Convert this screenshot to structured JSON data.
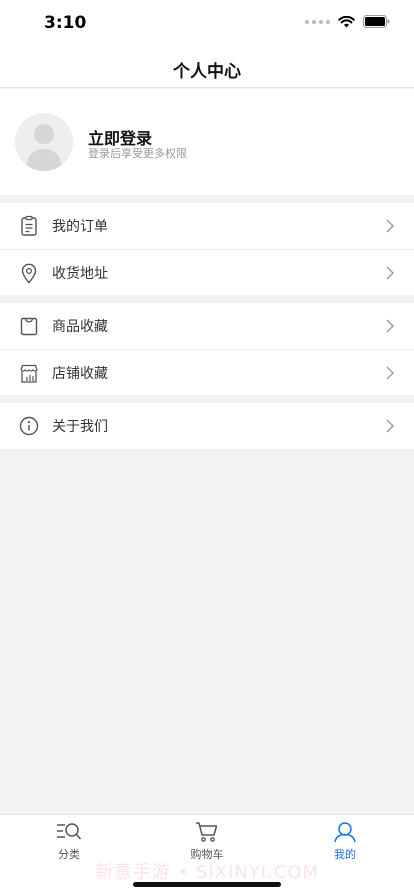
{
  "status_bar": {
    "time": "3:10"
  },
  "nav": {
    "title": "个人中心"
  },
  "profile": {
    "login_title": "立即登录",
    "login_subtitle": "登录后享受更多权限"
  },
  "menu_groups": [
    [
      {
        "label": "我的订单",
        "icon": "order-list-icon"
      },
      {
        "label": "收货地址",
        "icon": "location-pin-icon"
      }
    ],
    [
      {
        "label": "商品收藏",
        "icon": "shopping-bag-icon"
      },
      {
        "label": "店铺收藏",
        "icon": "store-icon"
      }
    ],
    [
      {
        "label": "关于我们",
        "icon": "info-icon"
      }
    ]
  ],
  "tab_bar": {
    "tabs": [
      {
        "label": "分类",
        "icon": "category-search-icon",
        "active": false
      },
      {
        "label": "购物车",
        "icon": "cart-icon",
        "active": false
      },
      {
        "label": "我的",
        "icon": "user-icon",
        "active": true
      }
    ],
    "active_color": "#1a73e8"
  },
  "watermark": "新意手游 • SIXINYI.COM"
}
